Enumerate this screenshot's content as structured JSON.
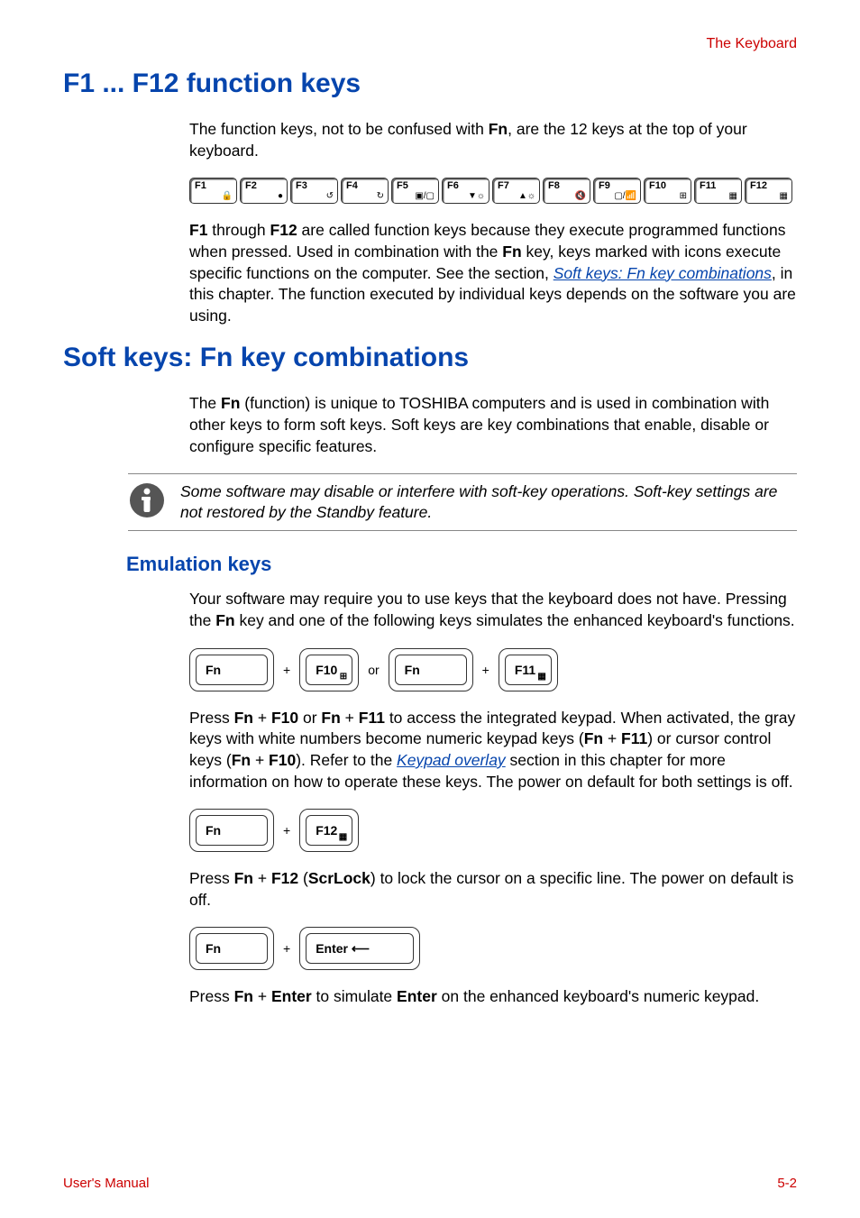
{
  "header": {
    "right": "The Keyboard"
  },
  "section1": {
    "title": "F1 ... F12 function keys",
    "para1_a": "The function keys, not to be confused with ",
    "para1_b": "Fn",
    "para1_c": ", are the 12 keys at the top of your keyboard.",
    "fkeys": [
      "F1",
      "F2",
      "F3",
      "F4",
      "F5",
      "F6",
      "F7",
      "F8",
      "F9",
      "F10",
      "F11",
      "F12"
    ],
    "fkey_icons": [
      "🔒",
      "●",
      "↺",
      "↻",
      "▣/▢",
      "▼☼",
      "▲☼",
      "🔇",
      "▢/📶",
      "⊞",
      "▦",
      "▦"
    ],
    "para2_a": "F1",
    "para2_b": " through ",
    "para2_c": "F12",
    "para2_d": " are called function keys because they execute programmed functions when pressed. Used in combination with the ",
    "para2_e": "Fn",
    "para2_f": " key, keys marked with icons execute specific functions on the computer. See the section, ",
    "para2_link": "Soft keys: Fn key combinations",
    "para2_g": ", in this chapter. The function executed by individual keys depends on the software you are using."
  },
  "section2": {
    "title": "Soft keys: Fn key combinations",
    "para1_a": "The ",
    "para1_b": "Fn",
    "para1_c": " (function) is unique to TOSHIBA computers and is used in combination with other keys to form soft keys. Soft keys are key combinations that enable, disable or configure specific features.",
    "note": "Some software may disable or interfere with soft-key operations. Soft-key settings are not restored by the Standby feature.",
    "sub_title": "Emulation keys",
    "para2_a": "Your software may require you to use keys that the keyboard does not have. Pressing the ",
    "para2_b": "Fn",
    "para2_c": " key and one of the following keys simulates the enhanced keyboard's functions.",
    "combo1": {
      "k1": "Fn",
      "plus": "+",
      "k2": "F10",
      "or": "or",
      "k3": "Fn",
      "k4": "F11"
    },
    "para3_a": "Press ",
    "para3_b": "Fn",
    "para3_c": " + ",
    "para3_d": "F10",
    "para3_e": " or ",
    "para3_f": "Fn",
    "para3_g": " + ",
    "para3_h": "F11",
    "para3_i": " to access the integrated keypad. When activated, the gray keys with white numbers become numeric keypad keys (",
    "para3_j": "Fn",
    "para3_k": " + ",
    "para3_l": "F11",
    "para3_m": ") or cursor control keys (",
    "para3_n": "Fn",
    "para3_o": " + ",
    "para3_p": "F10",
    "para3_q": "). Refer to the ",
    "para3_link": "Keypad overlay",
    "para3_r": " section in this chapter for more information on how to operate these keys. The power on default for both settings is off.",
    "combo2": {
      "k1": "Fn",
      "plus": "+",
      "k2": "F12"
    },
    "para4_a": "Press ",
    "para4_b": "Fn",
    "para4_c": " + ",
    "para4_d": "F12",
    "para4_e": " (",
    "para4_f": "ScrLock",
    "para4_g": ") to lock the cursor on a specific line. The power on default is off.",
    "combo3": {
      "k1": "Fn",
      "plus": "+",
      "k2": "Enter ⟵"
    },
    "para5_a": "Press ",
    "para5_b": "Fn",
    "para5_c": " + ",
    "para5_d": "Enter",
    "para5_e": " to simulate ",
    "para5_f": "Enter",
    "para5_g": " on the enhanced keyboard's numeric keypad."
  },
  "footer": {
    "left": "User's Manual",
    "right": "5-2"
  }
}
